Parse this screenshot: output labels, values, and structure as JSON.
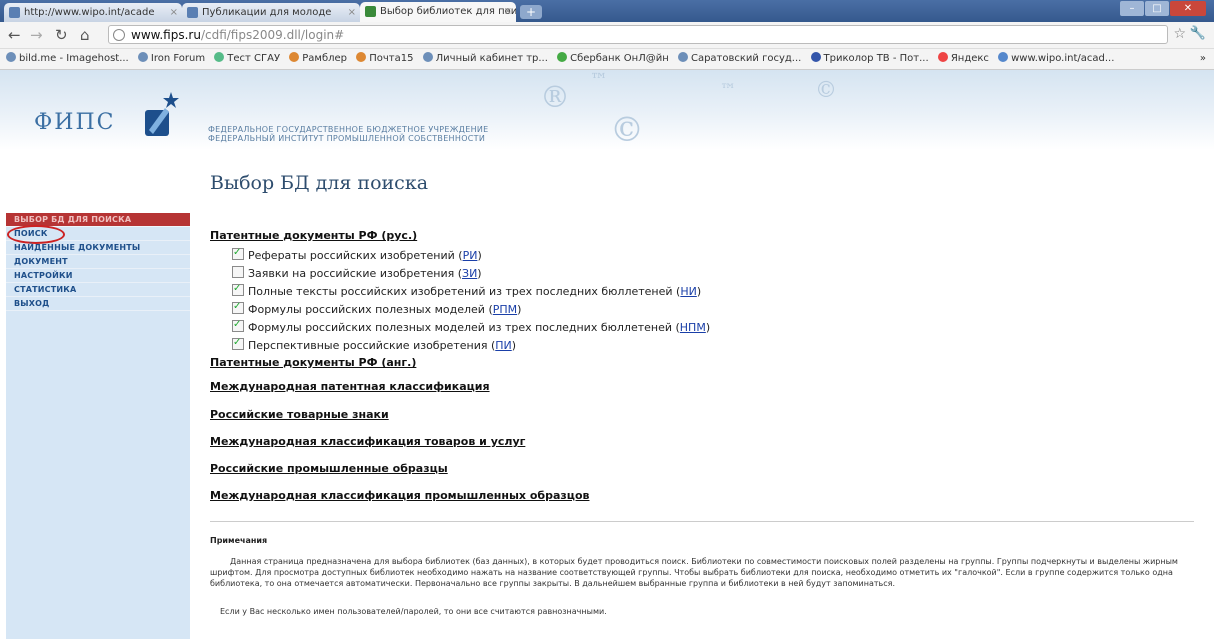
{
  "browser": {
    "tabs": [
      {
        "label": "http://www.wipo.int/acade"
      },
      {
        "label": "Публикации для молоде"
      },
      {
        "label": "Выбор библиотек для пои"
      }
    ],
    "url_host": "www.fips.ru",
    "url_path": "/cdfi/fips2009.dll/login#",
    "bookmarks": [
      "bild.me - Imagehost...",
      "Iron Forum",
      "Тест СГАУ",
      "Рамблер",
      "Почта15",
      "Личный кабинет тр...",
      "Сбербанк ОнЛ@йн",
      "Саратовский госуд...",
      "Триколор ТВ - Пот...",
      "Яндекс",
      "www.wipo.int/acad..."
    ],
    "bookmarks_more": "»"
  },
  "header": {
    "logo_text": "ФИПС",
    "org_line1": "ФЕДЕРАЛЬНОЕ ГОСУДАРСТВЕННОЕ БЮДЖЕТНОЕ УЧРЕЖДЕНИЕ",
    "org_line2": "ФЕДЕРАЛЬНЫЙ ИНСТИТУТ ПРОМЫШЛЕННОЙ СОБСТВЕННОСТИ"
  },
  "page_title": "Выбор БД для поиска",
  "sidebar": {
    "items": [
      {
        "label": "ВЫБОР БД ДЛЯ ПОИСКА"
      },
      {
        "label": "ПОИСК"
      },
      {
        "label": "НАЙДЕННЫЕ ДОКУМЕНТЫ"
      },
      {
        "label": "ДОКУМЕНТ"
      },
      {
        "label": "НАСТРОЙКИ"
      },
      {
        "label": "СТАТИСТИКА"
      },
      {
        "label": "ВЫХОД"
      }
    ]
  },
  "groups": {
    "rus": "Патентные документы РФ (рус.)",
    "eng": "Патентные документы РФ (анг.)",
    "ipc": "Международная патентная классификация",
    "tm": "Российские товарные знаки",
    "nice": "Международная классификация товаров и услуг",
    "designs": "Российские промышленные образцы",
    "locarno": "Международная классификация промышленных образцов"
  },
  "databases": [
    {
      "label": "Рефераты российских изобретений (",
      "code": "РИ",
      "tail": ")",
      "checked": true
    },
    {
      "label": "Заявки на российские изобретения (",
      "code": "ЗИ",
      "tail": ")",
      "checked": false
    },
    {
      "label": "Полные тексты российских изобретений из трех последних бюллетеней (",
      "code": "НИ",
      "tail": ")",
      "checked": true
    },
    {
      "label": "Формулы российских полезных моделей (",
      "code": "РПМ",
      "tail": ")",
      "checked": true
    },
    {
      "label": "Формулы российских полезных моделей из трех последних бюллетеней (",
      "code": "НПМ",
      "tail": ")",
      "checked": true
    },
    {
      "label": "Перспективные российские изобретения (",
      "code": "ПИ",
      "tail": ")",
      "checked": true
    }
  ],
  "notes": {
    "heading": "Примечания",
    "p1": "Данная страница предназначена для выбора библиотек (баз данных), в которых будет проводиться поиск. Библиотеки по совместимости поисковых полей разделены на группы. Группы подчеркнуты и выделены жирным шрифтом. Для просмотра доступных библиотек необходимо нажать на название соответствующей группы. Чтобы выбрать библиотеки для поиска, необходимо отметить их \"галочкой\". Если в группе содержится только одна библиотека, то она отмечается автоматически. Первоначально все группы закрыты. В дальнейшем выбранные группа и библиотеки в ней будут запоминаться.",
    "p2": "Если у Вас несколько имен пользователей/паролей, то они все считаются равнозначными."
  },
  "colors": {
    "sidebar_bg": "#d6e6f5",
    "sidebar_active": "#b63434",
    "link": "#1a3fa8",
    "title": "#2e4d6e"
  }
}
